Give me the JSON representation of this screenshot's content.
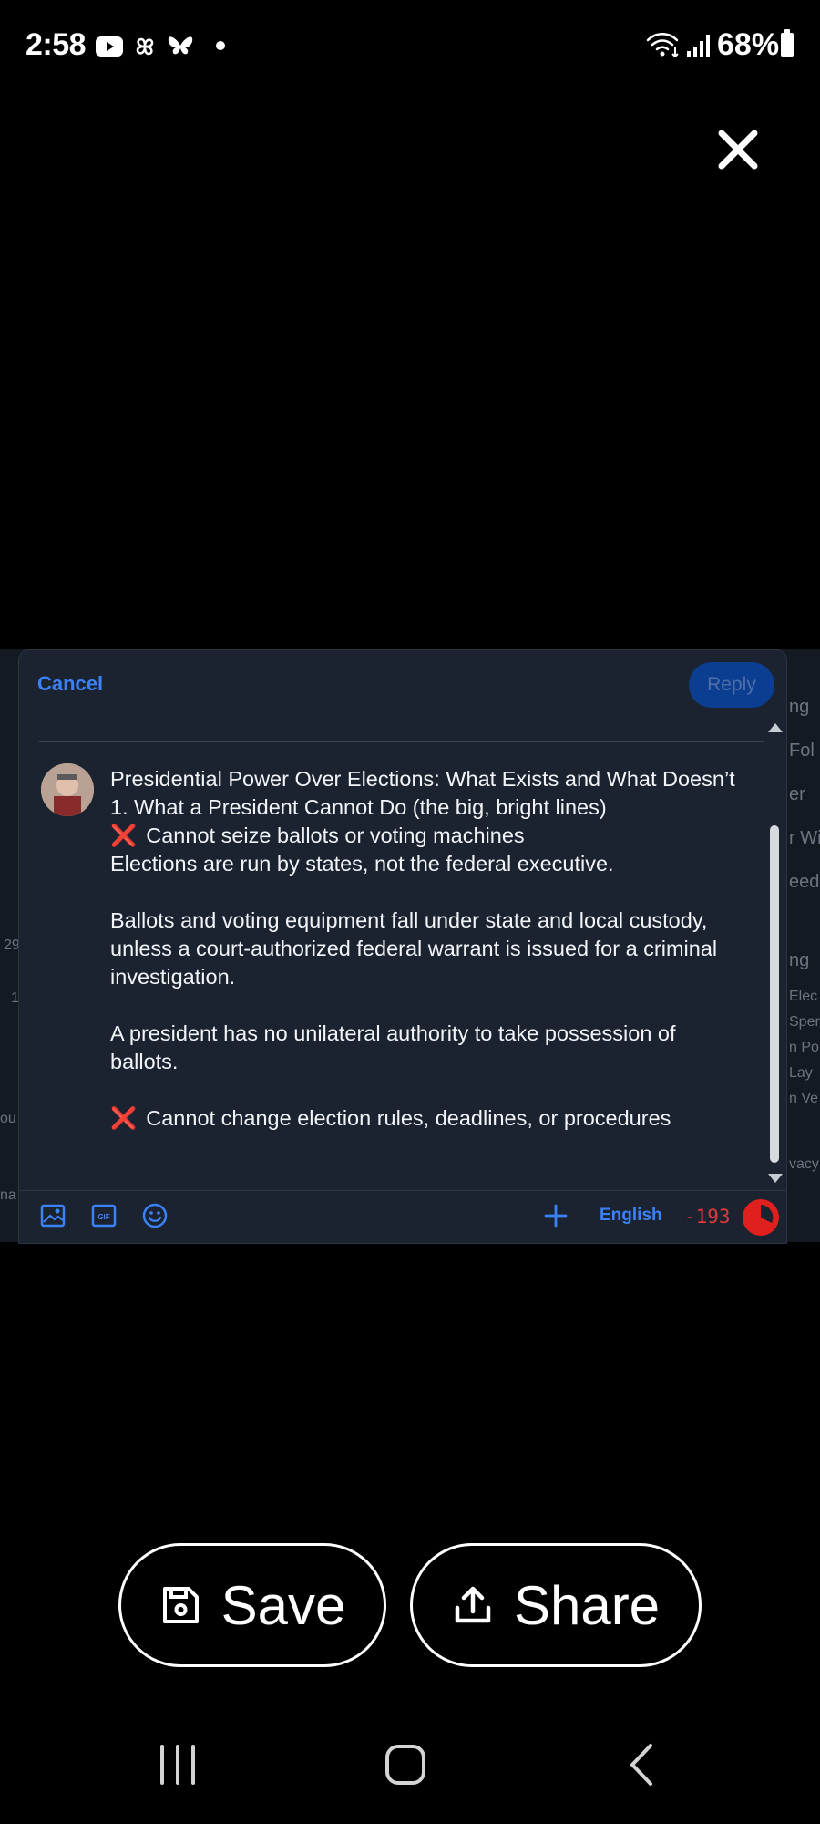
{
  "status_bar": {
    "time": "2:58",
    "battery": "68%",
    "icons": [
      "youtube-icon",
      "pinwheel-app-icon",
      "butterfly-icon",
      "dot-indicator",
      "wifi-icon",
      "signal-icon",
      "battery-icon"
    ]
  },
  "background_fragments": [
    "ng",
    "Fol",
    "er",
    "r Wi",
    "eeds",
    "ng",
    "Elec",
    "Sper",
    "n Po",
    "Lay",
    "n Ve",
    "vacy",
    "29",
    "1",
    "ou",
    "na"
  ],
  "composer": {
    "cancel_label": "Cancel",
    "reply_label": "Reply",
    "post_lines": {
      "l1": "Presidential Power Over Elections: What Exists and What Doesn’t",
      "l2": "1. What a President Cannot Do (the big, bright lines)",
      "l3_mark": "❌",
      "l3": "Cannot seize ballots or voting machines",
      "l4": "Elections are run by states, not the federal executive.",
      "l5": "Ballots and voting equipment fall under state and local custody, unless a court-authorized federal warrant is issued for a criminal investigation.",
      "l6": "A president has no unilateral authority to take possession of ballots.",
      "l7_mark": "❌",
      "l7": "Cannot change election rules, deadlines, or procedures"
    },
    "toolbar": {
      "icons": [
        "image-icon",
        "gif-icon",
        "emoji-icon",
        "add-icon"
      ],
      "gif_text": "GIF",
      "language": "English",
      "char_count": "-193"
    }
  },
  "actions": {
    "save_label": "Save",
    "share_label": "Share"
  },
  "nav_bar": {
    "icons": [
      "recent-apps-icon",
      "home-icon",
      "back-icon"
    ]
  },
  "colors": {
    "accent": "#3b82f6",
    "reply_button": "#0b3d91",
    "warning_red": "#e03a3a",
    "x_mark": "#f0456f",
    "composer_bg": "#1b2230"
  }
}
